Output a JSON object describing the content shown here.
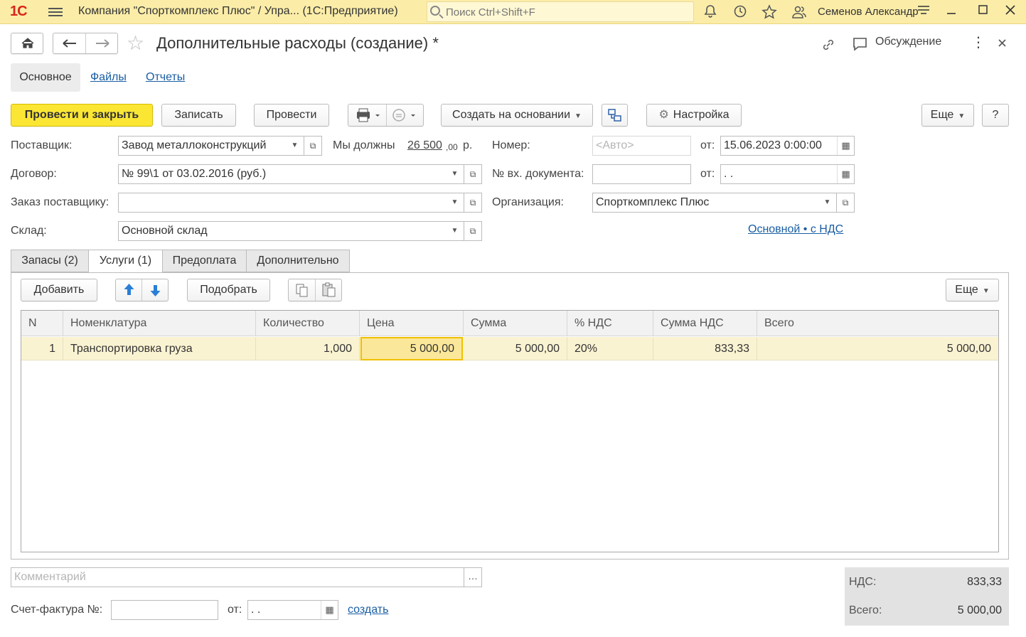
{
  "topbar": {
    "logo": "1С",
    "app_title": "Компания \"Спорткомплекс Плюс\" / Упра...  (1С:Предприятие)",
    "search_placeholder": "Поиск Ctrl+Shift+F",
    "user": "Семенов Александр"
  },
  "header": {
    "title": "Дополнительные расходы (создание) *",
    "discussion": "Обсуждение"
  },
  "form_tabs": {
    "main": "Основное",
    "files": "Файлы",
    "reports": "Отчеты"
  },
  "commands": {
    "post_close": "Провести и закрыть",
    "save": "Записать",
    "post": "Провести",
    "create_based": "Создать на основании",
    "settings": "Настройка",
    "more": "Еще",
    "help": "?"
  },
  "form": {
    "supplier_label": "Поставщик:",
    "supplier_value": "Завод металлоконструкций",
    "we_owe_label": "Мы должны",
    "we_owe_amount": "26 500",
    "we_owe_cents": ",00",
    "we_owe_currency": "р.",
    "number_label": "Номер:",
    "number_placeholder": "<Авто>",
    "date_from_label": "от:",
    "date_value": "15.06.2023  0:00:00",
    "contract_label": "Договор:",
    "contract_value": "№ 99\\1 от 03.02.2016 (руб.)",
    "in_doc_label": "№ вх. документа:",
    "in_doc_value": "",
    "in_doc_date_label": "от:",
    "in_doc_date_value": " .  .",
    "order_label": "Заказ поставщику:",
    "order_value": "",
    "org_label": "Организация:",
    "org_value": "Спорткомплекс Плюс",
    "warehouse_label": "Склад:",
    "warehouse_value": "Основной склад",
    "vat_link": "Основной • с НДС"
  },
  "section_tabs": [
    "Запасы (2)",
    "Услуги (1)",
    "Предоплата",
    "Дополнительно"
  ],
  "table_toolbar": {
    "add": "Добавить",
    "pick": "Подобрать",
    "more": "Еще"
  },
  "table": {
    "columns": [
      "N",
      "Номенклатура",
      "Количество",
      "Цена",
      "Сумма",
      "% НДС",
      "Сумма НДС",
      "Всего"
    ],
    "rows": [
      {
        "n": "1",
        "item": "Транспортировка груза",
        "qty": "1,000",
        "price": "5 000,00",
        "sum": "5 000,00",
        "vat_rate": "20%",
        "vat_sum": "833,33",
        "total": "5 000,00"
      }
    ]
  },
  "bottom": {
    "comment_placeholder": "Комментарий",
    "invoice_label": "Счет-фактура №:",
    "invoice_date_label": "от:",
    "invoice_date_value": " .  .",
    "create_link": "создать",
    "vat_label": "НДС:",
    "vat_value": "833,33",
    "total_label": "Всего:",
    "total_value": "5 000,00"
  }
}
